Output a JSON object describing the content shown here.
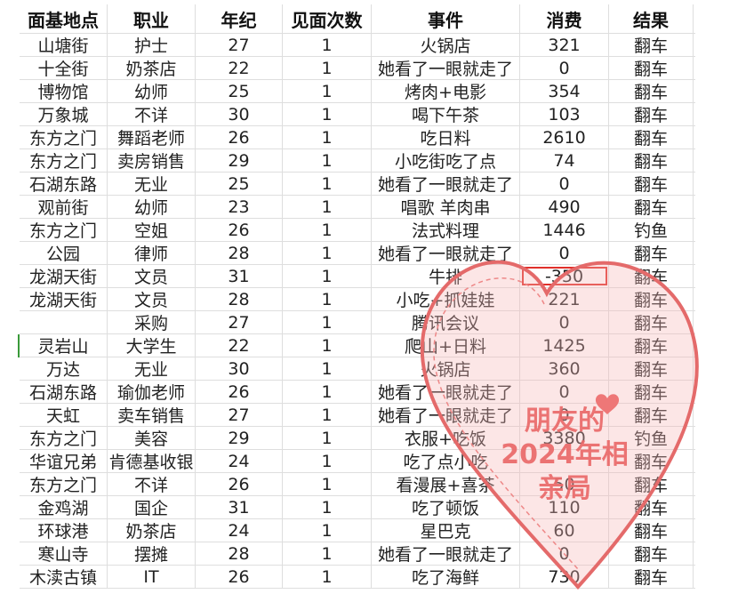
{
  "headers": [
    "面基地点",
    "职业",
    "年纪",
    "见面次数",
    "事件",
    "消费",
    "结果"
  ],
  "rows": [
    [
      "山塘街",
      "护士",
      "27",
      "1",
      "火锅店",
      "321",
      "翻车"
    ],
    [
      "十全街",
      "奶茶店",
      "22",
      "1",
      "她看了一眼就走了",
      "0",
      "翻车"
    ],
    [
      "博物馆",
      "幼师",
      "25",
      "1",
      "烤肉+电影",
      "354",
      "翻车"
    ],
    [
      "万象城",
      "不详",
      "30",
      "1",
      "喝下午茶",
      "103",
      "翻车"
    ],
    [
      "东方之门",
      "舞蹈老师",
      "26",
      "1",
      "吃日料",
      "2610",
      "翻车"
    ],
    [
      "东方之门",
      "卖房销售",
      "29",
      "1",
      "小吃街吃了点",
      "74",
      "翻车"
    ],
    [
      "石湖东路",
      "无业",
      "25",
      "1",
      "她看了一眼就走了",
      "0",
      "翻车"
    ],
    [
      "观前街",
      "幼师",
      "23",
      "1",
      "唱歌 羊肉串",
      "490",
      "翻车"
    ],
    [
      "东方之门",
      "空姐",
      "26",
      "1",
      "法式料理",
      "1446",
      "钓鱼"
    ],
    [
      "公园",
      "律师",
      "28",
      "1",
      "她看了一眼就走了",
      "0",
      "翻车"
    ],
    [
      "龙湖天街",
      "文员",
      "31",
      "1",
      "牛排",
      "-350",
      "翻车"
    ],
    [
      "龙湖天街",
      "文员",
      "28",
      "1",
      "小吃+抓娃娃",
      "221",
      "翻车"
    ],
    [
      "",
      "采购",
      "27",
      "1",
      "腾讯会议",
      "0",
      "翻车"
    ],
    [
      "灵岩山",
      "大学生",
      "22",
      "1",
      "爬山+日料",
      "1425",
      "翻车"
    ],
    [
      "万达",
      "无业",
      "30",
      "1",
      "火锅店",
      "360",
      "翻车"
    ],
    [
      "石湖东路",
      "瑜伽老师",
      "26",
      "1",
      "她看了一眼就走了",
      "0",
      "翻车"
    ],
    [
      "天虹",
      "卖车销售",
      "27",
      "1",
      "她看了一眼就走了",
      "0",
      "翻车"
    ],
    [
      "东方之门",
      "美容",
      "29",
      "1",
      "衣服+吃饭",
      "3380",
      "钓鱼"
    ],
    [
      "华谊兄弟",
      "肯德基收银",
      "24",
      "1",
      "吃了点小吃",
      "",
      "翻车"
    ],
    [
      "东方之门",
      "不详",
      "26",
      "1",
      "看漫展+喜茶",
      "50",
      "翻车"
    ],
    [
      "金鸡湖",
      "国企",
      "31",
      "1",
      "吃了顿饭",
      "110",
      "翻车"
    ],
    [
      "环球港",
      "奶茶店",
      "24",
      "1",
      "星巴克",
      "60",
      "翻车"
    ],
    [
      "寒山寺",
      "摆摊",
      "28",
      "1",
      "她看了一眼就走了",
      "0",
      "翻车"
    ],
    [
      "木渎古镇",
      "IT",
      "26",
      "1",
      "吃了海鲜",
      "730",
      "翻车"
    ]
  ],
  "highlighted_cell": {
    "row": 10,
    "col": 5,
    "color": "#e0302a"
  },
  "overlay": {
    "caption_lines": [
      "朋友的",
      "2024年相",
      "亲局"
    ],
    "color": "#ea6a6a",
    "icon": "heart-icon"
  }
}
